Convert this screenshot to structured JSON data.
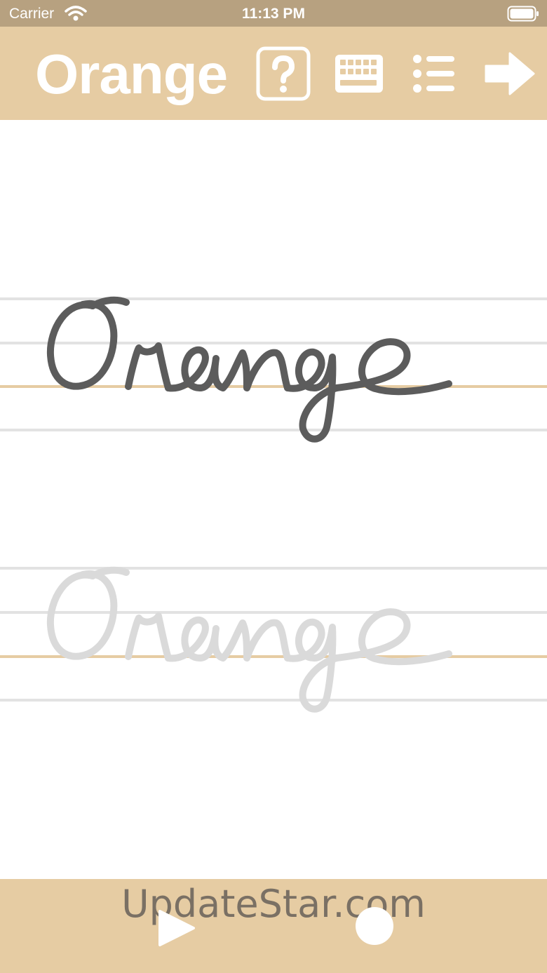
{
  "status_bar": {
    "carrier": "Carrier",
    "time": "11:13 PM"
  },
  "toolbar": {
    "title": "Orange",
    "help_icon": "question-mark-icon",
    "keyboard_icon": "keyboard-icon",
    "list_icon": "list-icon",
    "next_icon": "arrow-right-icon"
  },
  "practice": {
    "word": "Orange",
    "model_color": "#5c5c5c",
    "trace_color": "#dadada",
    "guide_color": "#e2e2e2",
    "baseline_color": "#e6cca3"
  },
  "bottom_bar": {
    "watermark": "UpdateStar.com",
    "play_icon": "play-icon",
    "record_icon": "record-icon"
  },
  "colors": {
    "toolbar": "#e6cca3",
    "status_bar": "#b7a180",
    "accent": "#ffffff"
  }
}
